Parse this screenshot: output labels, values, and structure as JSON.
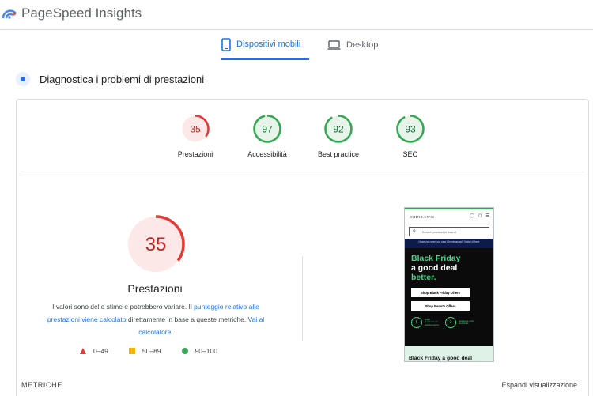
{
  "header": {
    "brand": "PageSpeed Insights"
  },
  "tabs": [
    {
      "label": "Dispositivi mobili",
      "active": true,
      "icon": "smartphone-icon"
    },
    {
      "label": "Desktop",
      "active": false,
      "icon": "laptop-icon"
    }
  ],
  "section": {
    "title": "Diagnostica i problemi di prestazioni"
  },
  "scores": [
    {
      "label": "Prestazioni",
      "value": 35,
      "color": "#e53935",
      "bg": "#fce8e6"
    },
    {
      "label": "Accessibilità",
      "value": 97,
      "color": "#34a853",
      "bg": "#e6f4ea"
    },
    {
      "label": "Best practice",
      "value": 92,
      "color": "#34a853",
      "bg": "#e6f4ea"
    },
    {
      "label": "SEO",
      "value": 93,
      "color": "#34a853",
      "bg": "#e6f4ea"
    }
  ],
  "main": {
    "score": 35,
    "title": "Prestazioni",
    "disclaimer_1": "I valori sono delle stime e potrebbero variare. Il ",
    "disclaimer_link1": "punteggio relativo alle prestazioni viene calcolato",
    "disclaimer_2": " direttamente in base a queste metriche. ",
    "disclaimer_link2": "Vai al calcolatore",
    "disclaimer_3": "."
  },
  "legend": [
    {
      "range": "0–49",
      "shape": "triangle",
      "color": "#e53935"
    },
    {
      "range": "50–89",
      "shape": "square",
      "color": "#f4b400"
    },
    {
      "range": "90–100",
      "shape": "circle",
      "color": "#34a853"
    }
  ],
  "screenshot": {
    "store_name": "JOHN LEWIS",
    "icon_labels": [
      "Account",
      "Basket",
      "Menu"
    ],
    "search_placeholder": "Search product or brand",
    "promo": "Have you seen our new Christmas ad? Watch it here",
    "headline": [
      "Black Friday",
      "a good deal",
      "better."
    ],
    "buttons": [
      "Shop Black Friday Offers",
      "Shop Beauty Offers"
    ],
    "badges": [
      {
        "num": "5",
        "text": "years guarantee on selected items"
      },
      {
        "num": "2",
        "text": "guarantee most electricals"
      }
    ],
    "bottom": "Black Friday a good deal"
  },
  "footer": {
    "metrics": "METRICHE",
    "expand": "Espandi visualizzazione"
  }
}
